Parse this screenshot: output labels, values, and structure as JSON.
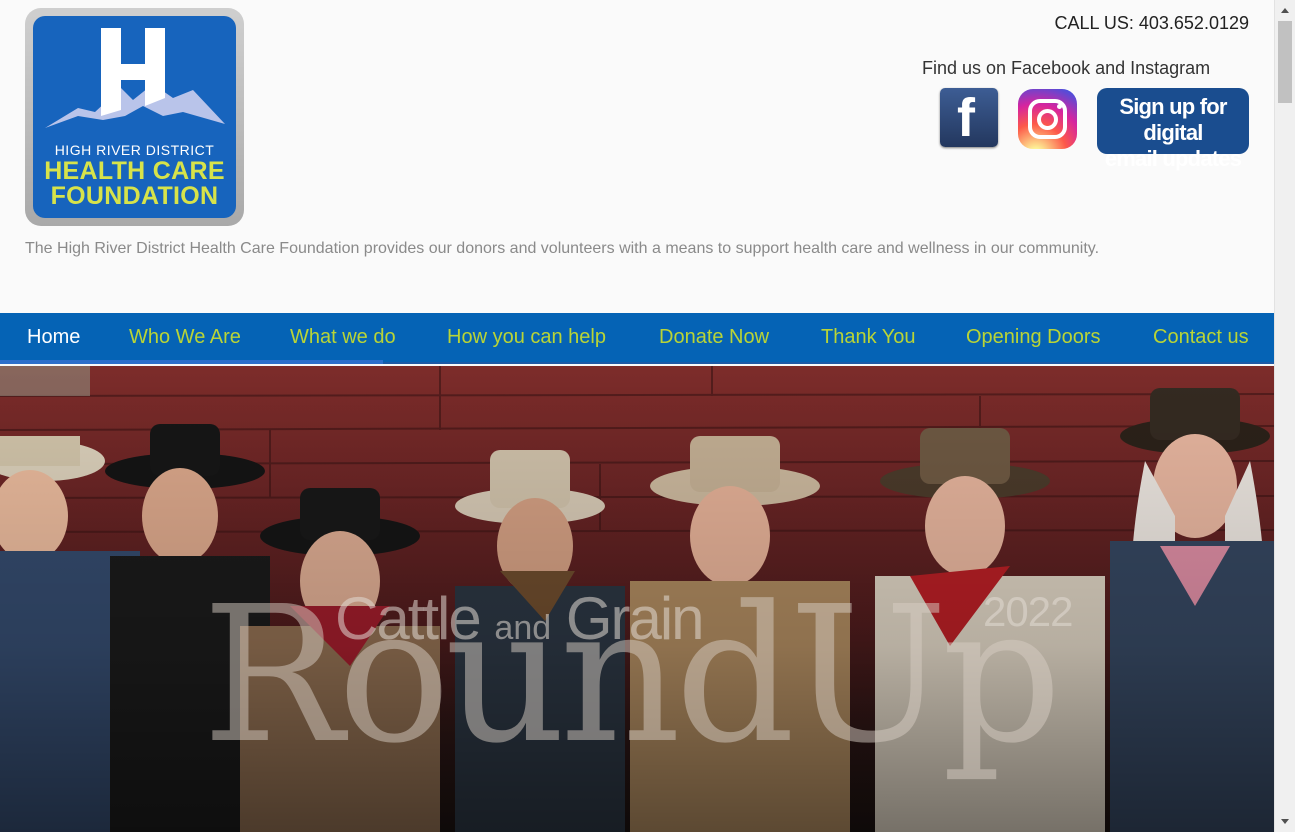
{
  "header": {
    "logo": {
      "line1": "HIGH RIVER DISTRICT",
      "line2": "HEALTH CARE",
      "line3": "FOUNDATION",
      "icon": "mountain-h-logo-icon"
    },
    "call_us": "CALL US: 403.652.0129",
    "social_label": "Find us on Facebook and Instagram",
    "social": [
      {
        "name": "facebook",
        "icon": "facebook-icon"
      },
      {
        "name": "instagram",
        "icon": "instagram-icon"
      }
    ],
    "signup_line1": "Sign up for digital",
    "signup_line2": "email updates",
    "tagline": "The High River District Health Care Foundation provides our donors and volunteers with a means to support health care and wellness in our community."
  },
  "nav": {
    "items": [
      {
        "label": "Home",
        "active": true
      },
      {
        "label": "Who We Are",
        "active": false
      },
      {
        "label": "What we do",
        "active": false
      },
      {
        "label": "How you can help",
        "active": false
      },
      {
        "label": "Donate Now",
        "active": false
      },
      {
        "label": "Thank You",
        "active": false
      },
      {
        "label": "Opening Doors",
        "active": false
      },
      {
        "label": "Contact us",
        "active": false
      }
    ]
  },
  "hero": {
    "line_cattle": "Cattle",
    "line_and": "and",
    "line_grain": "Grain",
    "year": "2022",
    "title": "RoundUp"
  },
  "colors": {
    "brand_blue": "#0563b5",
    "nav_link": "#b9d436",
    "logo_green": "#d7e34a"
  }
}
